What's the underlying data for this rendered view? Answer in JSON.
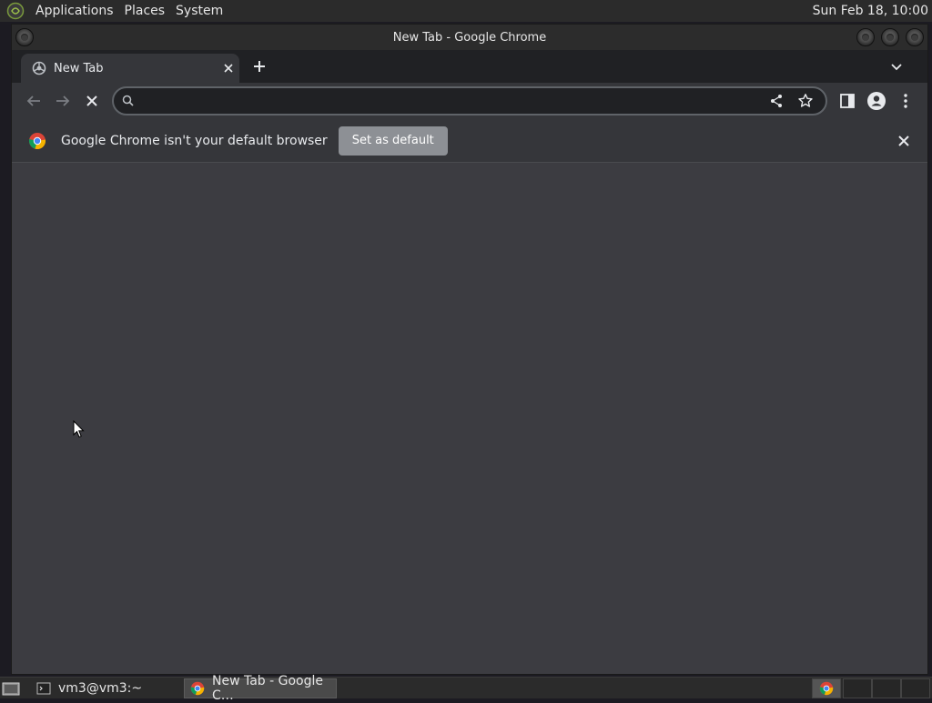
{
  "top_panel": {
    "menus": [
      "Applications",
      "Places",
      "System"
    ],
    "clock": "Sun Feb 18, 10:00"
  },
  "window": {
    "title": "New Tab - Google Chrome"
  },
  "browser": {
    "tab": {
      "title": "New Tab"
    },
    "omnibox": {
      "value": ""
    },
    "infobar": {
      "message": "Google Chrome isn't your default browser",
      "button_label": "Set as default"
    }
  },
  "taskbar": {
    "tasks": [
      {
        "label": "vm3@vm3:~",
        "icon": "terminal-icon"
      },
      {
        "label": "New Tab - Google C…",
        "icon": "chrome-icon"
      }
    ]
  },
  "colors": {
    "panel_bg": "#2b2b2b",
    "tabstrip_bg": "#202124",
    "toolbar_bg": "#35363a",
    "content_bg": "#3c3c41",
    "button_bg": "#8d9095"
  }
}
